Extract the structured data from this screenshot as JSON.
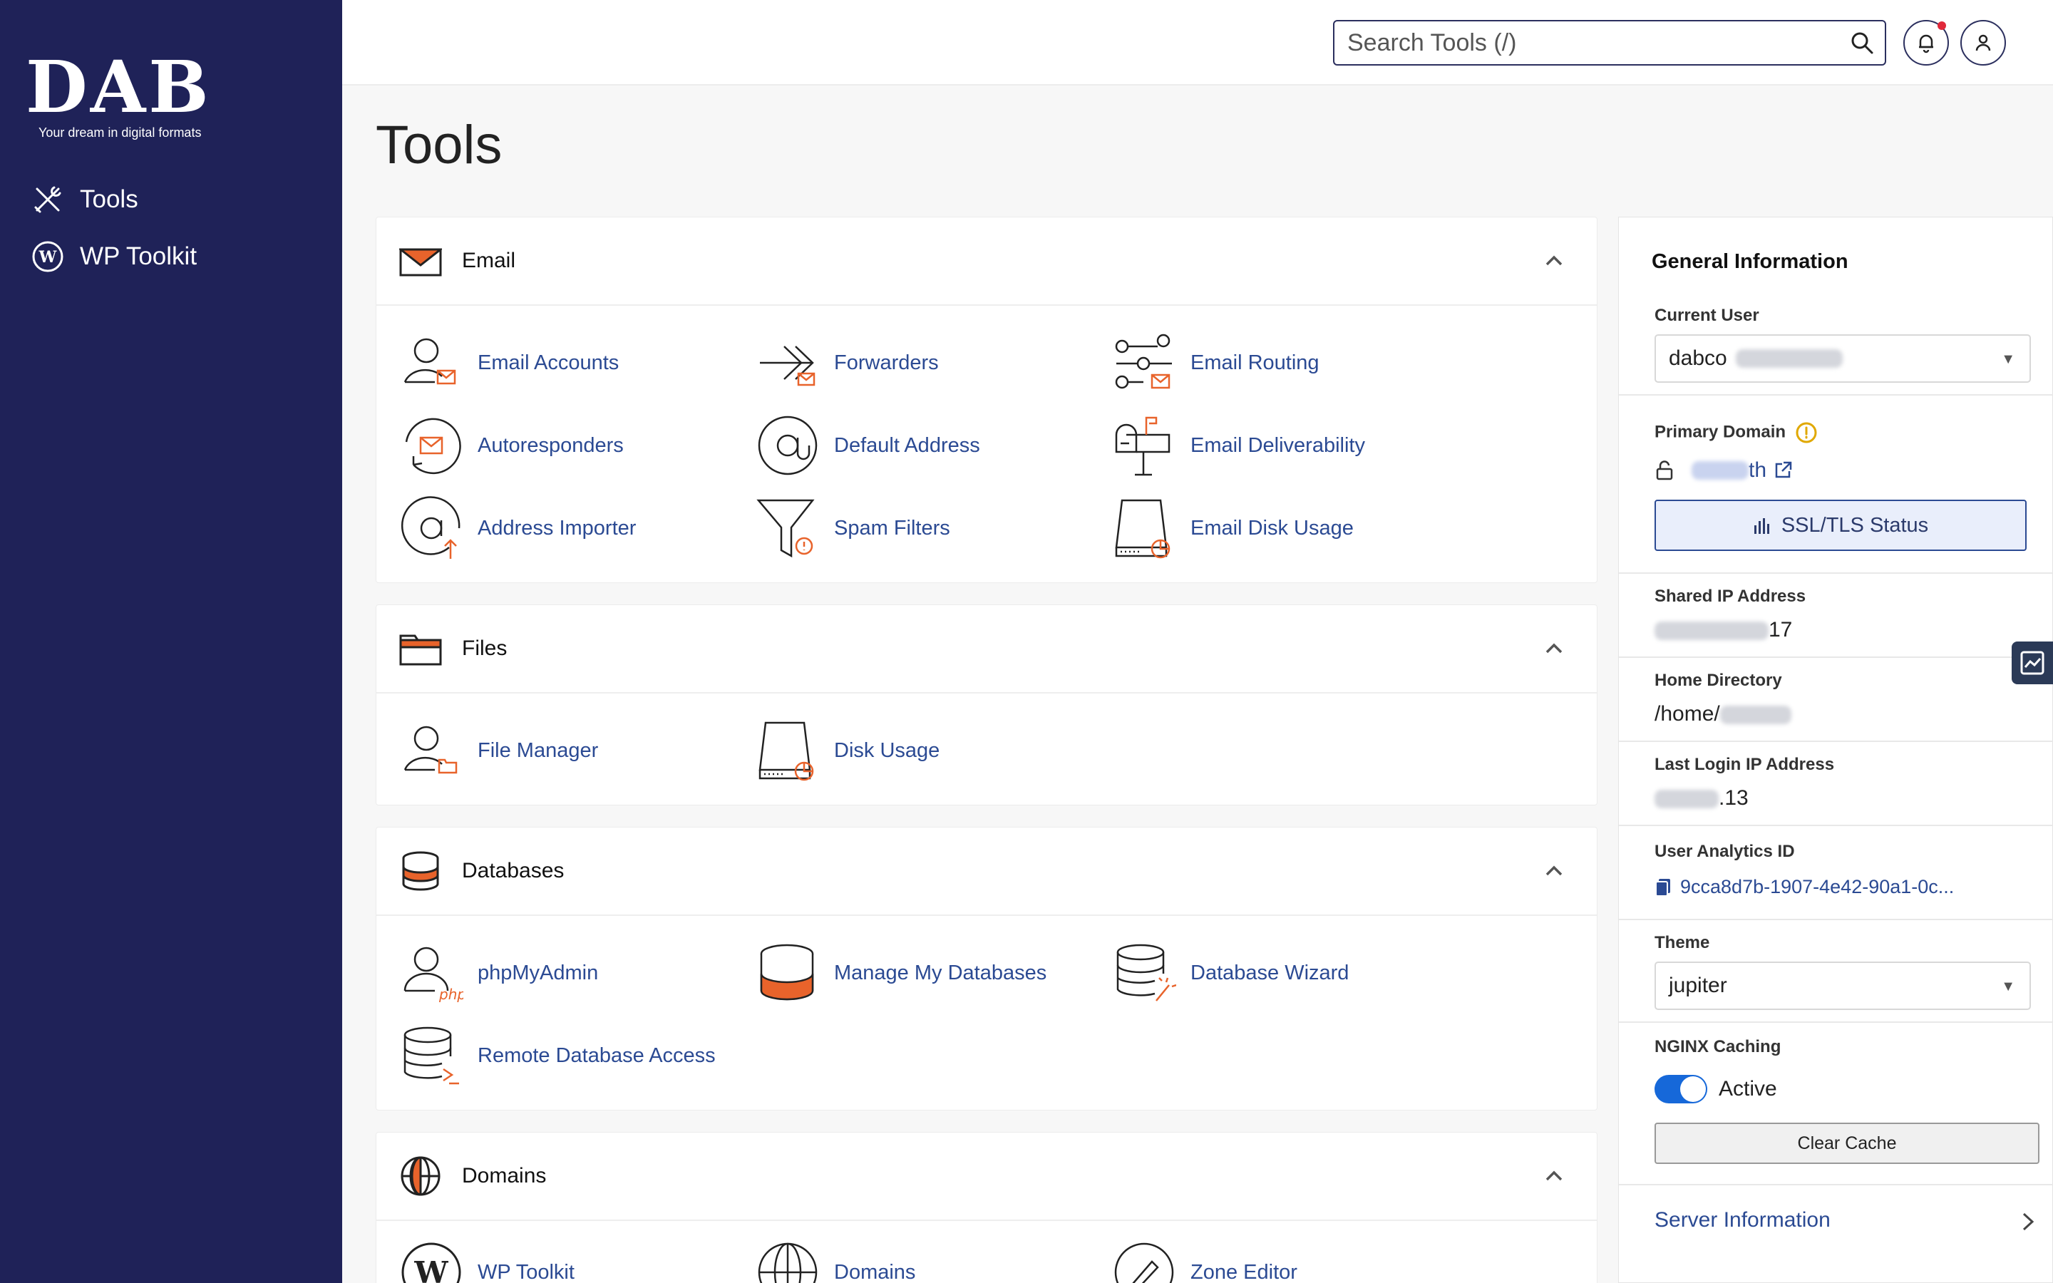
{
  "brand": {
    "logo": "DAB",
    "tagline": "Your dream in digital formats"
  },
  "sidebar": {
    "items": [
      {
        "label": "Tools",
        "icon": "tools-icon"
      },
      {
        "label": "WP Toolkit",
        "icon": "wordpress-icon"
      }
    ]
  },
  "header": {
    "search_placeholder": "Search Tools (/)",
    "has_notification": true
  },
  "page": {
    "title": "Tools"
  },
  "panels": {
    "email": {
      "title": "Email",
      "tools": [
        "Email Accounts",
        "Forwarders",
        "Email Routing",
        "Autoresponders",
        "Default Address",
        "Email Deliverability",
        "Address Importer",
        "Spam Filters",
        "Email Disk Usage"
      ]
    },
    "files": {
      "title": "Files",
      "tools": [
        "File Manager",
        "Disk Usage"
      ]
    },
    "databases": {
      "title": "Databases",
      "tools": [
        "phpMyAdmin",
        "Manage My Databases",
        "Database Wizard",
        "Remote Database Access"
      ]
    },
    "domains": {
      "title": "Domains",
      "tools": [
        "WP Toolkit",
        "Domains",
        "Zone Editor"
      ]
    }
  },
  "info": {
    "title": "General Information",
    "current_user_label": "Current User",
    "current_user_value": "dabco",
    "primary_domain_label": "Primary Domain",
    "primary_domain_suffix": "th",
    "ssl_button": "SSL/TLS Status",
    "shared_ip_label": "Shared IP Address",
    "shared_ip_suffix": "17",
    "home_dir_label": "Home Directory",
    "home_dir_value": "/home/",
    "last_login_label": "Last Login IP Address",
    "last_login_suffix": ".13",
    "analytics_label": "User Analytics ID",
    "analytics_value": "9cca8d7b-1907-4e42-90a1-0c...",
    "theme_label": "Theme",
    "theme_value": "jupiter",
    "nginx_label": "NGINX Caching",
    "nginx_status": "Active",
    "clear_cache": "Clear Cache",
    "server_info": "Server Information"
  },
  "colors": {
    "sidebar": "#1f2258",
    "accent": "#e8632b",
    "link": "#2b4a93",
    "toggle": "#1668d9"
  }
}
